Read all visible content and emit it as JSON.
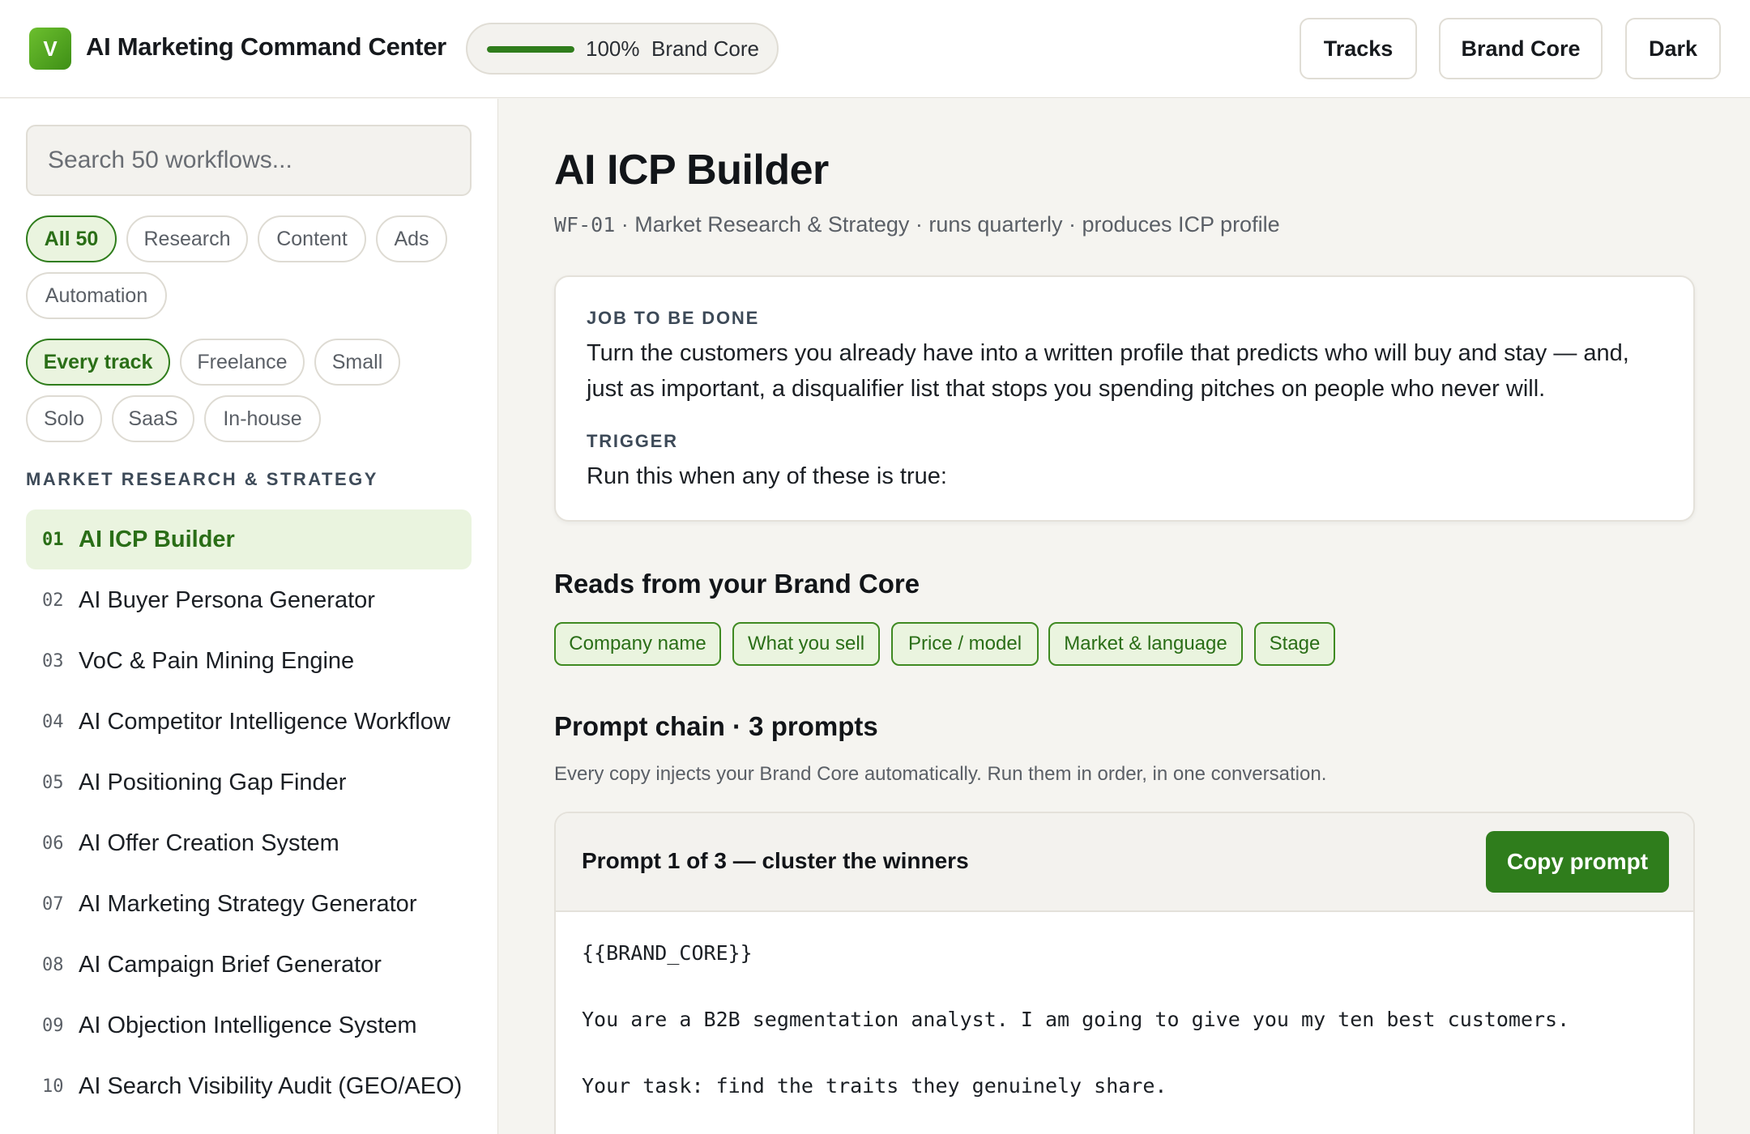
{
  "header": {
    "logo_letter": "V",
    "title": "AI Marketing Command Center",
    "progress": {
      "percent_value": 1.0,
      "percent_label": "100%",
      "label": "Brand Core"
    },
    "buttons": {
      "tracks": "Tracks",
      "brand_core": "Brand Core",
      "dark": "Dark"
    }
  },
  "sidebar": {
    "search_placeholder": "Search 50 workflows...",
    "category_filters": [
      "All 50",
      "Research",
      "Content",
      "Ads",
      "Automation"
    ],
    "track_filters": [
      "Every track",
      "Freelance",
      "Small",
      "Solo",
      "SaaS",
      "In-house"
    ],
    "section_label": "MARKET RESEARCH & STRATEGY",
    "workflows": [
      {
        "num": "01",
        "name": "AI ICP Builder"
      },
      {
        "num": "02",
        "name": "AI Buyer Persona Generator"
      },
      {
        "num": "03",
        "name": "VoC & Pain Mining Engine"
      },
      {
        "num": "04",
        "name": "AI Competitor Intelligence Workflow"
      },
      {
        "num": "05",
        "name": "AI Positioning Gap Finder"
      },
      {
        "num": "06",
        "name": "AI Offer Creation System"
      },
      {
        "num": "07",
        "name": "AI Marketing Strategy Generator"
      },
      {
        "num": "08",
        "name": "AI Campaign Brief Generator"
      },
      {
        "num": "09",
        "name": "AI Objection Intelligence System"
      },
      {
        "num": "10",
        "name": "AI Search Visibility Audit (GEO/AEO)"
      }
    ]
  },
  "main": {
    "title": "AI ICP Builder",
    "meta_code": "WF-01",
    "meta_rest": " · Market Research & Strategy · runs quarterly · produces ICP profile",
    "job_label": "JOB TO BE DONE",
    "job_text": "Turn the customers you already have into a written profile that predicts who will buy and stay — and, just as important, a disqualifier list that stops you spending pitches on people who never will.",
    "trigger_label": "TRIGGER",
    "trigger_text": "Run this when any of these is true:",
    "reads_heading": "Reads from your Brand Core",
    "reads_tags": [
      "Company name",
      "What you sell",
      "Price / model",
      "Market & language",
      "Stage"
    ],
    "chain_heading": "Prompt chain · 3 prompts",
    "chain_note": "Every copy injects your Brand Core automatically. Run them in order, in one conversation.",
    "prompt": {
      "title": "Prompt 1 of 3 — cluster the winners",
      "copy_label": "Copy prompt",
      "lines": [
        "{{BRAND_CORE}}",
        "You are a B2B segmentation analyst. I am going to give you my ten best customers.",
        "Your task: find the traits they genuinely share."
      ]
    }
  }
}
